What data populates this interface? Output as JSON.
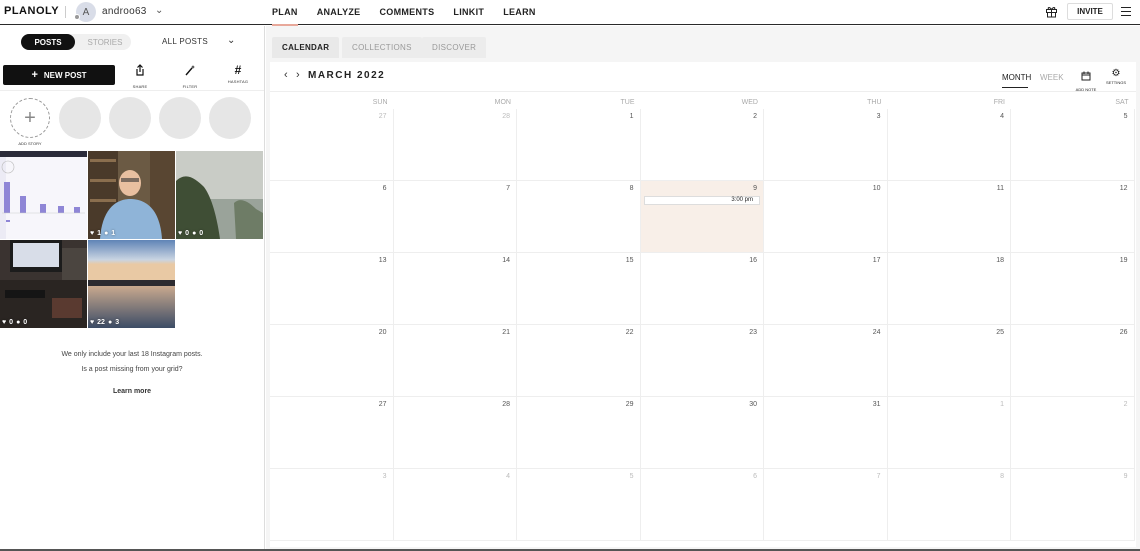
{
  "app": {
    "logo": "PLANOLY",
    "account_initial": "A",
    "account_name": "androo63"
  },
  "nav": {
    "items": [
      {
        "label": "PLAN",
        "active": true
      },
      {
        "label": "ANALYZE",
        "active": false
      },
      {
        "label": "COMMENTS",
        "active": false
      },
      {
        "label": "LINKIT",
        "active": false
      },
      {
        "label": "LEARN",
        "active": false
      }
    ],
    "invite_label": "INVITE"
  },
  "sidebar": {
    "toggle_posts": "POSTS",
    "toggle_stories": "STORIES",
    "filter_label": "ALL POSTS",
    "new_post_label": "NEW POST",
    "tools": [
      {
        "label": "SHARE",
        "icon": "share-icon"
      },
      {
        "label": "FILTER",
        "icon": "magic-wand-icon"
      },
      {
        "label": "HASHTAG",
        "icon": "hashtag-icon"
      }
    ],
    "add_story_label": "ADD STORY",
    "posts": [
      {
        "likes": "",
        "comments": "",
        "kind": "chart-screenshot"
      },
      {
        "likes": "1",
        "comments": "1",
        "kind": "person-portrait"
      },
      {
        "likes": "0",
        "comments": "0",
        "kind": "foggy-trees"
      },
      {
        "likes": "0",
        "comments": "0",
        "kind": "desk-computer"
      },
      {
        "likes": "22",
        "comments": "3",
        "kind": "lake-sunset"
      }
    ],
    "note_line1": "We only include your last 18 Instagram posts.",
    "note_line2": "Is a post missing from your grid?",
    "learn_more": "Learn more"
  },
  "subtabs": [
    {
      "label": "CALENDAR",
      "active": true
    },
    {
      "label": "COLLECTIONS",
      "active": false
    },
    {
      "label": "DISCOVER",
      "active": false
    }
  ],
  "calendar": {
    "title": "MARCH 2022",
    "view_month": "MONTH",
    "view_week": "WEEK",
    "add_note_label": "ADD NOTE",
    "settings_label": "SETTINGS",
    "weekdays": [
      "SUN",
      "MON",
      "TUE",
      "WED",
      "THU",
      "FRI",
      "SAT"
    ],
    "weeks": [
      [
        {
          "d": "27",
          "m": true
        },
        {
          "d": "28",
          "m": true
        },
        {
          "d": "1"
        },
        {
          "d": "2"
        },
        {
          "d": "3"
        },
        {
          "d": "4"
        },
        {
          "d": "5"
        }
      ],
      [
        {
          "d": "6"
        },
        {
          "d": "7"
        },
        {
          "d": "8"
        },
        {
          "d": "9",
          "today": true,
          "event": "3:00 pm"
        },
        {
          "d": "10"
        },
        {
          "d": "11"
        },
        {
          "d": "12"
        }
      ],
      [
        {
          "d": "13"
        },
        {
          "d": "14"
        },
        {
          "d": "15"
        },
        {
          "d": "16"
        },
        {
          "d": "17"
        },
        {
          "d": "18"
        },
        {
          "d": "19"
        }
      ],
      [
        {
          "d": "20"
        },
        {
          "d": "21"
        },
        {
          "d": "22"
        },
        {
          "d": "23"
        },
        {
          "d": "24"
        },
        {
          "d": "25"
        },
        {
          "d": "26"
        }
      ],
      [
        {
          "d": "27"
        },
        {
          "d": "28"
        },
        {
          "d": "29"
        },
        {
          "d": "30"
        },
        {
          "d": "31"
        },
        {
          "d": "1",
          "m": true
        },
        {
          "d": "2",
          "m": true
        }
      ],
      [
        {
          "d": "3",
          "m": true
        },
        {
          "d": "4",
          "m": true
        },
        {
          "d": "5",
          "m": true
        },
        {
          "d": "6",
          "m": true
        },
        {
          "d": "7",
          "m": true
        },
        {
          "d": "8",
          "m": true
        },
        {
          "d": "9",
          "m": true
        }
      ]
    ]
  },
  "colors": {
    "accent": "#e8a89a",
    "today_bg": "#f8efe8"
  }
}
